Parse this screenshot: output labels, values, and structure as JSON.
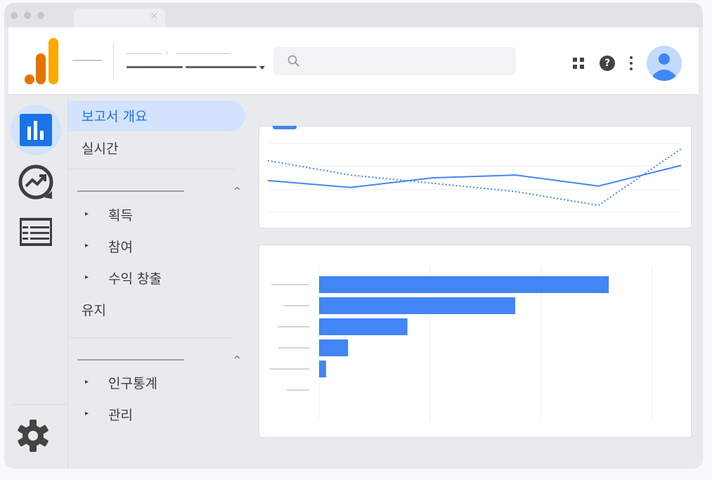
{
  "window": {
    "tab_close_glyph": "×"
  },
  "colors": {
    "accent": "#1a73e8",
    "bar": "#4285f4",
    "logo_orange": "#f9ab00",
    "logo_dark_orange": "#e37400"
  },
  "header": {
    "breadcrumb_separator": "›",
    "icons": [
      "analytics-logo-icon",
      "search-icon",
      "apps-grid-icon",
      "help-icon",
      "more-vert-icon",
      "account-avatar-icon"
    ],
    "help_glyph": "?"
  },
  "rail": {
    "items": [
      {
        "name": "reports-icon",
        "active": true
      },
      {
        "name": "explore-icon",
        "active": false
      },
      {
        "name": "advertising-list-icon",
        "active": false
      }
    ],
    "settings": "settings-gear-icon"
  },
  "sidebar": {
    "top_items": [
      {
        "label": "보고서 개요",
        "active": true
      },
      {
        "label": "실시간",
        "active": false
      }
    ],
    "section1": {
      "items": [
        {
          "label": "획득"
        },
        {
          "label": "참여"
        },
        {
          "label": "수익 창출"
        }
      ],
      "standalone": "유지"
    },
    "section2": {
      "items": [
        {
          "label": "인구통계"
        },
        {
          "label": "관리"
        }
      ]
    },
    "expand_glyph": "▸",
    "collapse_glyph": "^"
  },
  "chart_data": [
    {
      "type": "line",
      "x": [
        0,
        1,
        2,
        3,
        4,
        5
      ],
      "series": [
        {
          "style": "solid",
          "values": [
            26,
            16,
            30,
            34,
            18,
            48
          ]
        },
        {
          "style": "dotted",
          "values": [
            55,
            34,
            22,
            10,
            -10,
            72
          ]
        }
      ],
      "ylim": [
        -20,
        80
      ],
      "grid": true
    },
    {
      "type": "bar",
      "orientation": "horizontal",
      "categories": [
        "",
        "",
        "",
        "",
        "",
        ""
      ],
      "values": [
        100,
        67.7,
        30.5,
        10,
        2.4,
        0
      ],
      "xlim": [
        0,
        115
      ],
      "grid": true
    }
  ]
}
